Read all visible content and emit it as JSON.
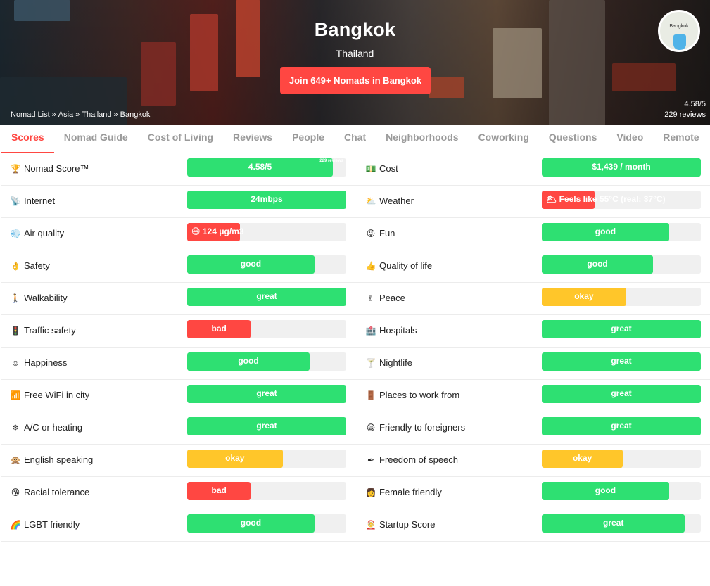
{
  "colors": {
    "accent": "#ff4742",
    "green": "#2ee072",
    "red": "#ff4742",
    "yellow": "#ffc62a",
    "track": "#f0f0f0"
  },
  "hero": {
    "city": "Bangkok",
    "country": "Thailand",
    "join_label": "Join 649+ Nomads in Bangkok",
    "breadcrumb": [
      "Nomad List",
      "Asia",
      "Thailand",
      "Bangkok"
    ],
    "breadcrumb_sep": "»",
    "rating": "4.58/5",
    "reviews": "229 reviews",
    "map_label": "Bangkok"
  },
  "tabs": [
    {
      "label": "Scores",
      "active": true
    },
    {
      "label": "Nomad Guide"
    },
    {
      "label": "Cost of Living"
    },
    {
      "label": "Reviews"
    },
    {
      "label": "People"
    },
    {
      "label": "Chat"
    },
    {
      "label": "Neighborhoods"
    },
    {
      "label": "Coworking"
    },
    {
      "label": "Questions"
    },
    {
      "label": "Video"
    },
    {
      "label": "Remote"
    }
  ],
  "rows": [
    {
      "left": {
        "icon": "🏆",
        "icon_name": "trophy-icon",
        "label": "Nomad Score™",
        "value": "4.58/5",
        "fill": 0.916,
        "color": "green",
        "note": "229 reviews"
      },
      "right": {
        "icon": "💵",
        "icon_name": "cash-icon",
        "label": "Cost",
        "value": "$1,439 / month",
        "fill": 1.0,
        "color": "green"
      }
    },
    {
      "left": {
        "icon": "📡",
        "icon_name": "satellite-dish-icon",
        "label": "Internet",
        "value": "24mbps",
        "fill": 1.0,
        "color": "green"
      },
      "right": {
        "icon": "⛅",
        "icon_name": "cloud-sun-icon",
        "label": "Weather",
        "value": "🌥 Feels like 55°C (real: 37°C)",
        "fill": 0.33,
        "color": "red",
        "align": "left"
      }
    },
    {
      "left": {
        "icon": "💨",
        "icon_name": "wind-icon",
        "label": "Air quality",
        "value": "😷 124 μg/m3",
        "fill": 0.33,
        "color": "red",
        "align": "left"
      },
      "right": {
        "icon": "😜",
        "icon_name": "winking-face-icon",
        "label": "Fun",
        "value": "good",
        "fill": 0.8,
        "color": "green"
      }
    },
    {
      "left": {
        "icon": "👌",
        "icon_name": "ok-hand-icon",
        "label": "Safety",
        "value": "good",
        "fill": 0.8,
        "color": "green"
      },
      "right": {
        "icon": "👍",
        "icon_name": "thumbs-up-icon",
        "label": "Quality of life",
        "value": "good",
        "fill": 0.7,
        "color": "green"
      }
    },
    {
      "left": {
        "icon": "🚶",
        "icon_name": "person-walking-icon",
        "label": "Walkability",
        "value": "great",
        "fill": 1.0,
        "color": "green"
      },
      "right": {
        "icon": "✌",
        "icon_name": "peace-hand-icon",
        "label": "Peace",
        "value": "okay",
        "fill": 0.53,
        "color": "yellow"
      }
    },
    {
      "left": {
        "icon": "🚦",
        "icon_name": "traffic-light-icon",
        "label": "Traffic safety",
        "value": "bad",
        "fill": 0.4,
        "color": "red"
      },
      "right": {
        "icon": "🏥",
        "icon_name": "hospital-icon",
        "label": "Hospitals",
        "value": "great",
        "fill": 1.0,
        "color": "green"
      }
    },
    {
      "left": {
        "icon": "☺",
        "icon_name": "smiling-face-icon",
        "label": "Happiness",
        "value": "good",
        "fill": 0.77,
        "color": "green"
      },
      "right": {
        "icon": "🍸",
        "icon_name": "cocktail-icon",
        "label": "Nightlife",
        "value": "great",
        "fill": 1.0,
        "color": "green"
      }
    },
    {
      "left": {
        "icon": "📶",
        "icon_name": "wifi-signal-icon",
        "label": "Free WiFi in city",
        "value": "great",
        "fill": 1.0,
        "color": "green"
      },
      "right": {
        "icon": "🚪",
        "icon_name": "door-icon",
        "label": "Places to work from",
        "value": "great",
        "fill": 1.0,
        "color": "green"
      }
    },
    {
      "left": {
        "icon": "❄",
        "icon_name": "snowflake-icon",
        "label": "A/C or heating",
        "value": "great",
        "fill": 1.0,
        "color": "green"
      },
      "right": {
        "icon": "😁",
        "icon_name": "grinning-face-icon",
        "label": "Friendly to foreigners",
        "value": "great",
        "fill": 1.0,
        "color": "green"
      }
    },
    {
      "left": {
        "icon": "🙊",
        "icon_name": "speak-no-evil-monkey-icon",
        "label": "English speaking",
        "value": "okay",
        "fill": 0.6,
        "color": "yellow"
      },
      "right": {
        "icon": "✒",
        "icon_name": "pen-nib-icon",
        "label": "Freedom of speech",
        "value": "okay",
        "fill": 0.51,
        "color": "yellow"
      }
    },
    {
      "left": {
        "icon": "😘",
        "icon_name": "kiss-face-icon",
        "label": "Racial tolerance",
        "value": "bad",
        "fill": 0.4,
        "color": "red"
      },
      "right": {
        "icon": "👩",
        "icon_name": "woman-icon",
        "label": "Female friendly",
        "value": "good",
        "fill": 0.8,
        "color": "green"
      }
    },
    {
      "left": {
        "icon": "🌈",
        "icon_name": "rainbow-icon",
        "label": "LGBT friendly",
        "value": "good",
        "fill": 0.8,
        "color": "green"
      },
      "right": {
        "icon": "🤶",
        "icon_name": "santa-face-icon",
        "label": "Startup Score",
        "value": "great",
        "fill": 0.9,
        "color": "green"
      }
    }
  ]
}
